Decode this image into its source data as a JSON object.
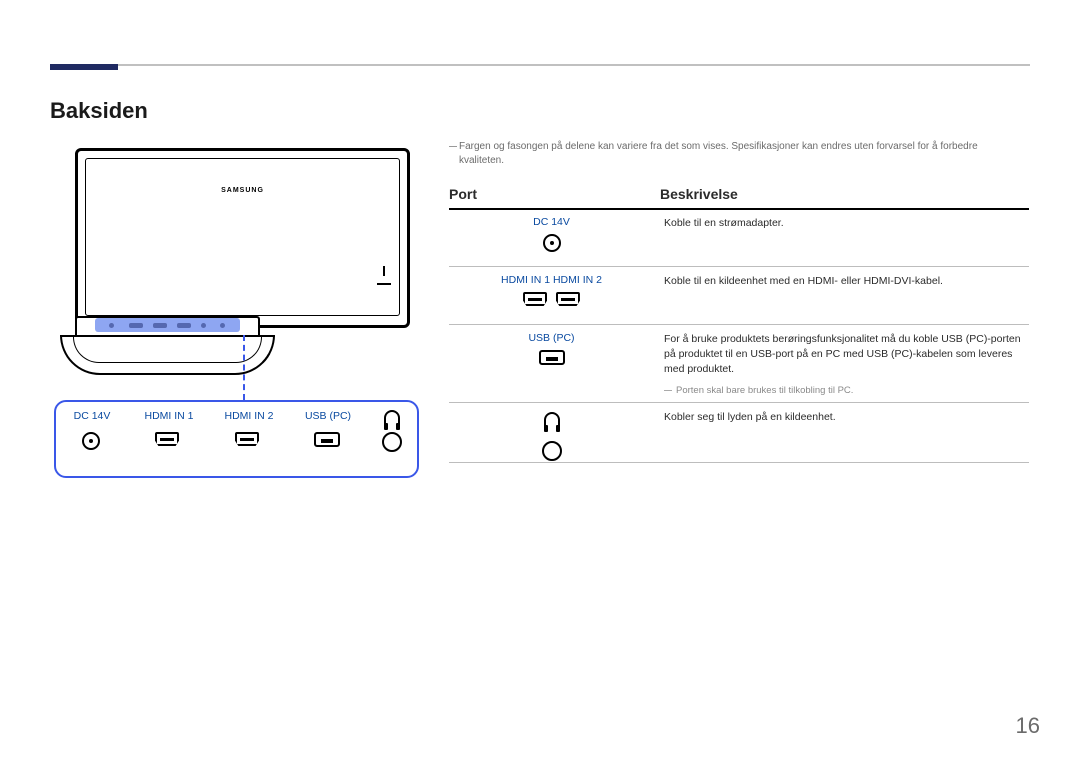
{
  "section_title": "Baksiden",
  "logo": "SAMSUNG",
  "note": "Fargen og fasongen på delene kan variere fra det som vises. Spesifikasjoner kan endres uten forvarsel for å forbedre kvaliteten.",
  "table": {
    "header_port": "Port",
    "header_desc": "Beskrivelse",
    "rows": [
      {
        "port_label": "DC 14V",
        "port_icon": "dc",
        "desc": "Koble til en strømadapter."
      },
      {
        "port_label": "HDMI IN 1   HDMI IN 2",
        "port_icon": "hdmi-pair",
        "desc": "Koble til en kildeenhet med en HDMI- eller HDMI-DVI-kabel."
      },
      {
        "port_label": "USB (PC)",
        "port_icon": "usb",
        "desc": "For å bruke produktets berøringsfunksjonalitet må du koble USB (PC)-porten på produktet til en USB-port på en PC med USB (PC)-kabelen som leveres med produktet.",
        "desc_sub": "Porten skal bare brukes til tilkobling til PC."
      },
      {
        "port_label": "",
        "port_icon": "headphone-circle",
        "desc": "Kobler seg til lyden på en kildeenhet."
      }
    ]
  },
  "port_box": {
    "items": [
      {
        "label": "DC 14V",
        "icon": "dc"
      },
      {
        "label": "HDMI IN 1",
        "icon": "hdmi"
      },
      {
        "label": "HDMI IN 2",
        "icon": "hdmi"
      },
      {
        "label": "USB (PC)",
        "icon": "usb"
      },
      {
        "label": "",
        "icon": "headphone"
      }
    ]
  },
  "page_number": "16"
}
